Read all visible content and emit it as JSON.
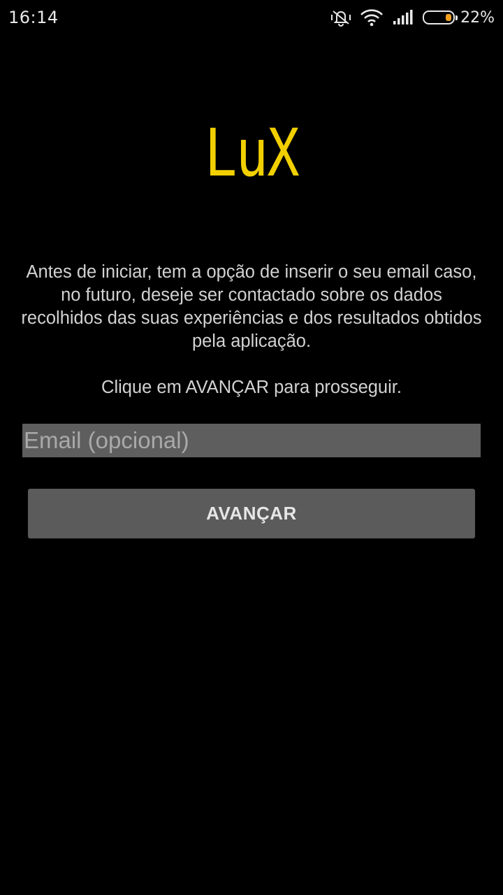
{
  "status_bar": {
    "time": "16:14",
    "battery_percent_label": "22%",
    "battery_level": 0.22,
    "battery_color": "#f0a020",
    "icons": [
      "mute-vibrate-icon",
      "wifi-icon",
      "cellular-signal-icon",
      "battery-icon"
    ]
  },
  "app": {
    "logo_text": "LuX",
    "logo_color": "#f2d000"
  },
  "content": {
    "intro_text": "Antes de iniciar, tem a opção de inserir o seu email caso, no futuro, deseje ser contactado sobre os dados recolhidos das suas experiências e dos resultados obtidos pela aplicação.",
    "instruction_text": "Clique em AVANÇAR para prosseguir."
  },
  "form": {
    "email_value": "",
    "email_placeholder": "Email (opcional)",
    "advance_label": "AVANÇAR"
  }
}
